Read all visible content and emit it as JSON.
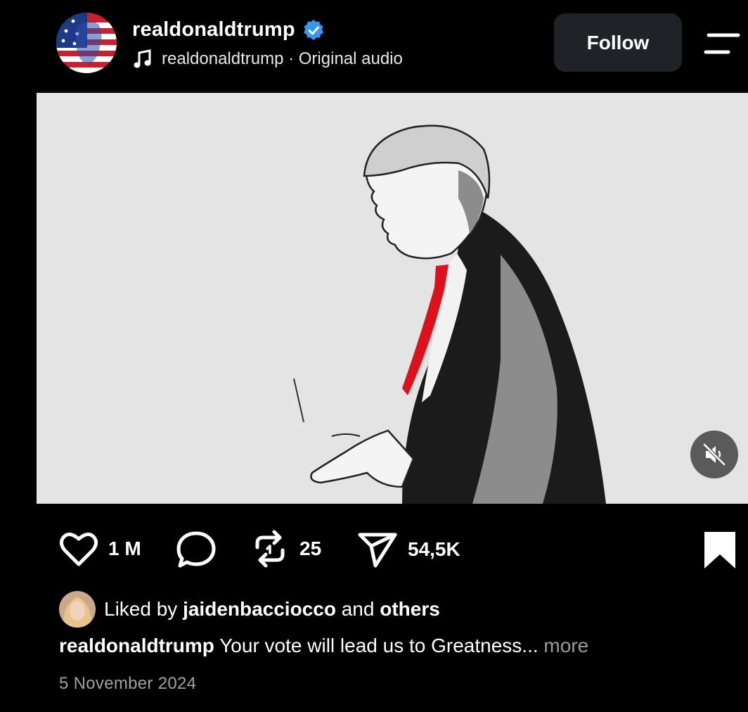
{
  "header": {
    "username": "realdonaldtrump",
    "audio_text": "realdonaldtrump · Original audio",
    "follow_label": "Follow"
  },
  "actions": {
    "likes": "1 M",
    "reposts": "25",
    "shares": "54,5K"
  },
  "liked_by": {
    "prefix": "Liked by",
    "user": "jaidenbacciocco",
    "middle": "and",
    "suffix": "others"
  },
  "caption": {
    "user": "realdonaldtrump",
    "text": "Your vote will lead us to Greatness...",
    "more": "more"
  },
  "date": "5 November 2024",
  "icons": {
    "verified": "verified-badge-icon",
    "note": "music-note-icon",
    "menu": "menu-icon",
    "heart": "heart-icon",
    "comment": "comment-icon",
    "repost": "repost-icon",
    "share": "send-icon",
    "bookmark": "bookmark-icon",
    "mute": "muted-speaker-icon"
  },
  "colors": {
    "background": "#000000",
    "verified": "#3897f0",
    "tie": "#e0101a",
    "follow_bg": "#1f2328"
  }
}
